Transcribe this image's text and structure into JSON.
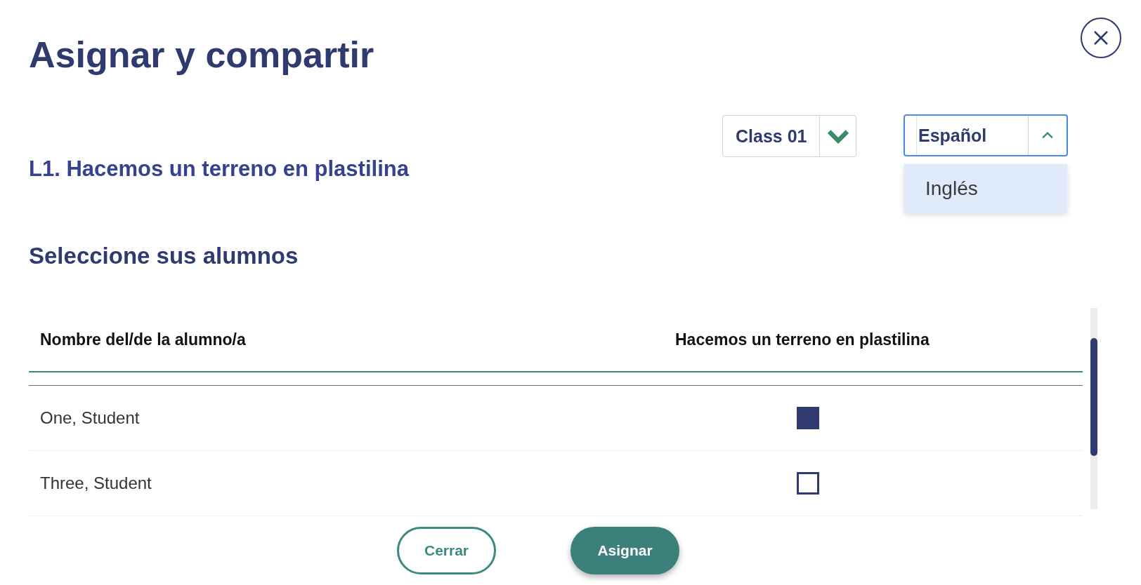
{
  "title": "Asignar y compartir",
  "class_select": {
    "value": "Class 01",
    "expanded": false
  },
  "language_select": {
    "value": "Español",
    "expanded": true,
    "options": [
      {
        "label": "Inglés",
        "highlighted": true
      }
    ]
  },
  "lesson_title": "L1. Hacemos un terreno en plastilina",
  "section_title": "Seleccione sus alumnos",
  "table": {
    "columns": [
      "Nombre del/de la alumno/a",
      "Hacemos un terreno en plastilina"
    ],
    "rows": [
      {
        "name": "One, Student",
        "checked": true
      },
      {
        "name": "Three, Student",
        "checked": false
      }
    ]
  },
  "buttons": [
    {
      "label": "Cerrar",
      "kind": "secondary"
    },
    {
      "label": "Asignar",
      "kind": "primary"
    }
  ]
}
